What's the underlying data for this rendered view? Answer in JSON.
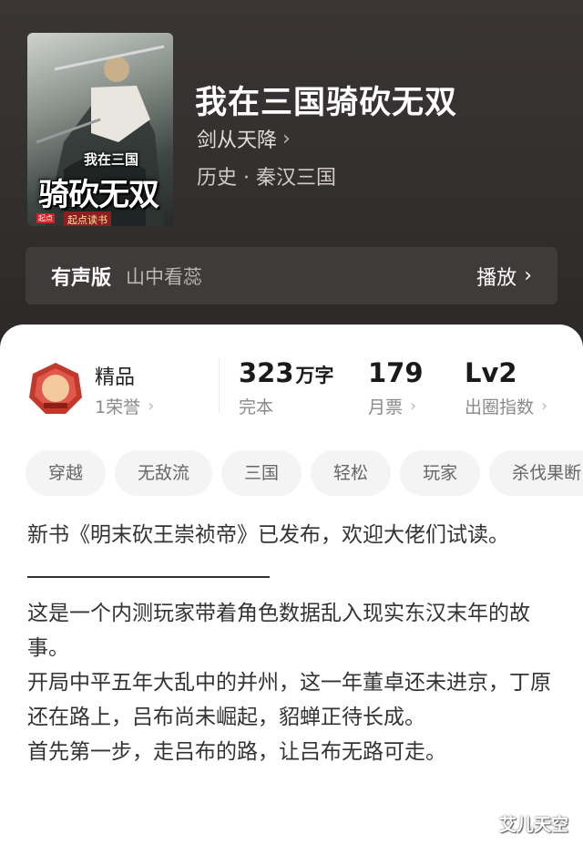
{
  "book": {
    "title": "我在三国骑砍无双",
    "author": "剑从天降",
    "category": "历史 · 秦汉三国",
    "cover": {
      "small_title": "我在三国",
      "big_title": "骑砍无双",
      "publisher": "起点读书",
      "tag": "起点"
    }
  },
  "audio": {
    "label": "有声版",
    "narrator": "山中看蕊",
    "play_label": "播放"
  },
  "honor": {
    "title": "精品",
    "sub": "1荣誉"
  },
  "stats": [
    {
      "value": "323",
      "unit": "万字",
      "label": "完本"
    },
    {
      "value": "179",
      "unit": "",
      "label": "月票"
    },
    {
      "value": "Lv2",
      "unit": "",
      "label": "出圈指数"
    }
  ],
  "tags": [
    "穿越",
    "无敌流",
    "三国",
    "轻松",
    "玩家",
    "杀伐果断"
  ],
  "description": {
    "notice": "新书《明末砍王崇祯帝》已发布，欢迎大佬们试读。",
    "p1": "这是一个内测玩家带着角色数据乱入现实东汉末年的故事。",
    "p2": "开局中平五年大乱中的并州，这一年董卓还未进京，丁原还在路上，吕布尚未崛起，貂蝉正待长成。",
    "p3": "首先第一步，走吕布的路，让吕布无路可走。"
  },
  "watermark": "艾儿天空",
  "colors": {
    "hero_bg": "#343030",
    "audio_bar_bg": "#3f3b3a",
    "tag_bg": "#f4f4f4",
    "badge_red": "#c0392b"
  },
  "icons": {
    "chevron": "chevron-right-icon",
    "badge": "quality-badge-icon"
  }
}
